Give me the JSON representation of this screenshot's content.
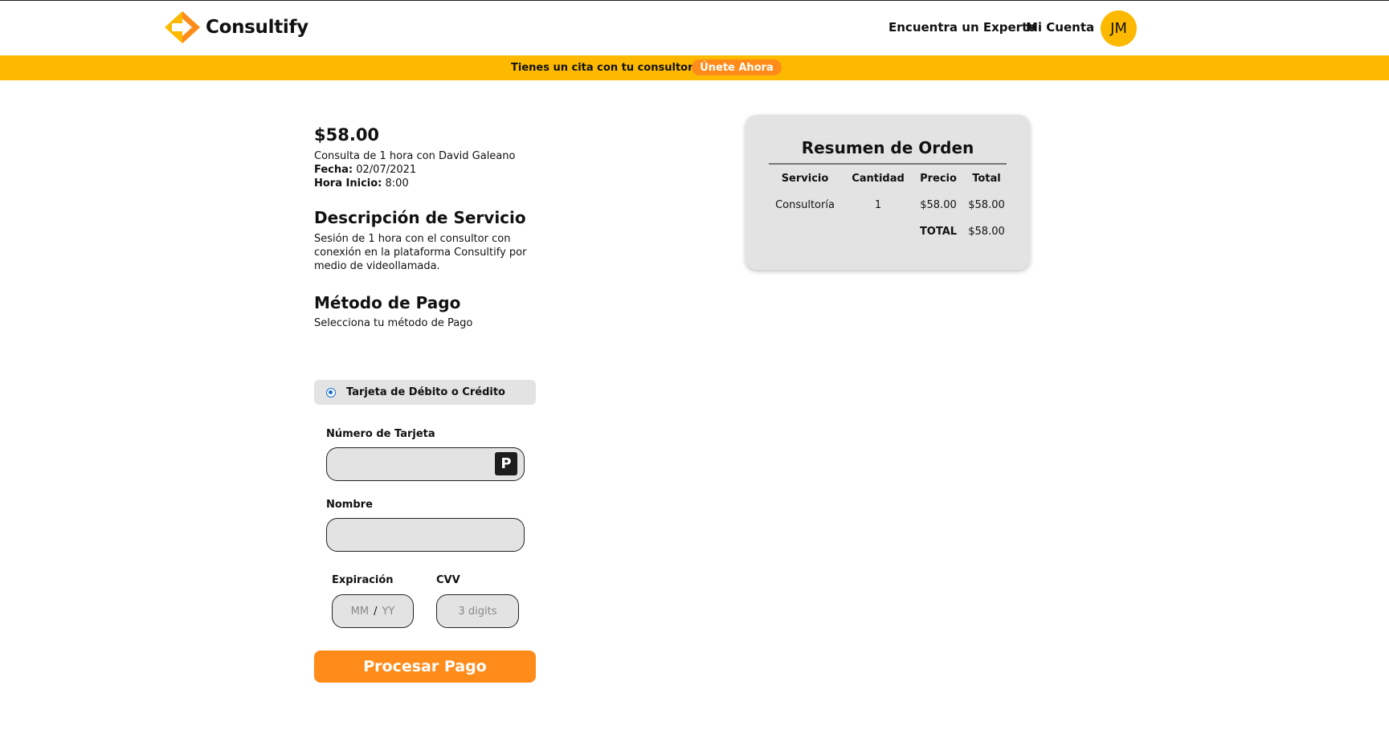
{
  "header": {
    "brand": "Consultify",
    "nav": [
      "Encuentra un Experto",
      "Mi Cuenta"
    ],
    "avatar_initials": "JM"
  },
  "banner": {
    "text": "Tienes un cita con tu consultor",
    "cta": "Únete Ahora"
  },
  "order": {
    "price": "$58.00",
    "description": "Consulta de 1 hora con David Galeano",
    "date_label": "Fecha:",
    "date_value": "02/07/2021",
    "time_label": "Hora Inicio:",
    "time_value": "8:00"
  },
  "service": {
    "title": "Descripción de Servicio",
    "text": "Sesión de 1 hora con el consultor con conexión en la plataforma Consultify por medio de videollamada."
  },
  "payment": {
    "title": "Método de Pago",
    "subtitle": "Selecciona tu método de Pago",
    "method_label": "Tarjeta de Débito o Crédito",
    "method_selected": true,
    "card_number_label": "Número de Tarjeta",
    "card_number_value": "",
    "card_badge": "P",
    "name_label": "Nombre",
    "name_value": "",
    "expiration_label": "Expiración",
    "expiration_month_placeholder": "MM",
    "expiration_separator": "/",
    "expiration_year_placeholder": "YY",
    "cvv_label": "CVV",
    "cvv_placeholder": "3 digits",
    "submit_label": "Procesar Pago"
  },
  "summary": {
    "title": "Resumen de Orden",
    "columns": [
      "Servicio",
      "Cantidad",
      "Precio",
      "Total"
    ],
    "rows": [
      [
        "Consultoría",
        "1",
        "$58.00",
        "$58.00"
      ]
    ],
    "total_label": "TOTAL",
    "total_value": "$58.00"
  },
  "colors": {
    "brand_yellow": "#fcb900",
    "brand_orange": "#ff8c1a",
    "panel_gray": "#e3e3e3"
  }
}
